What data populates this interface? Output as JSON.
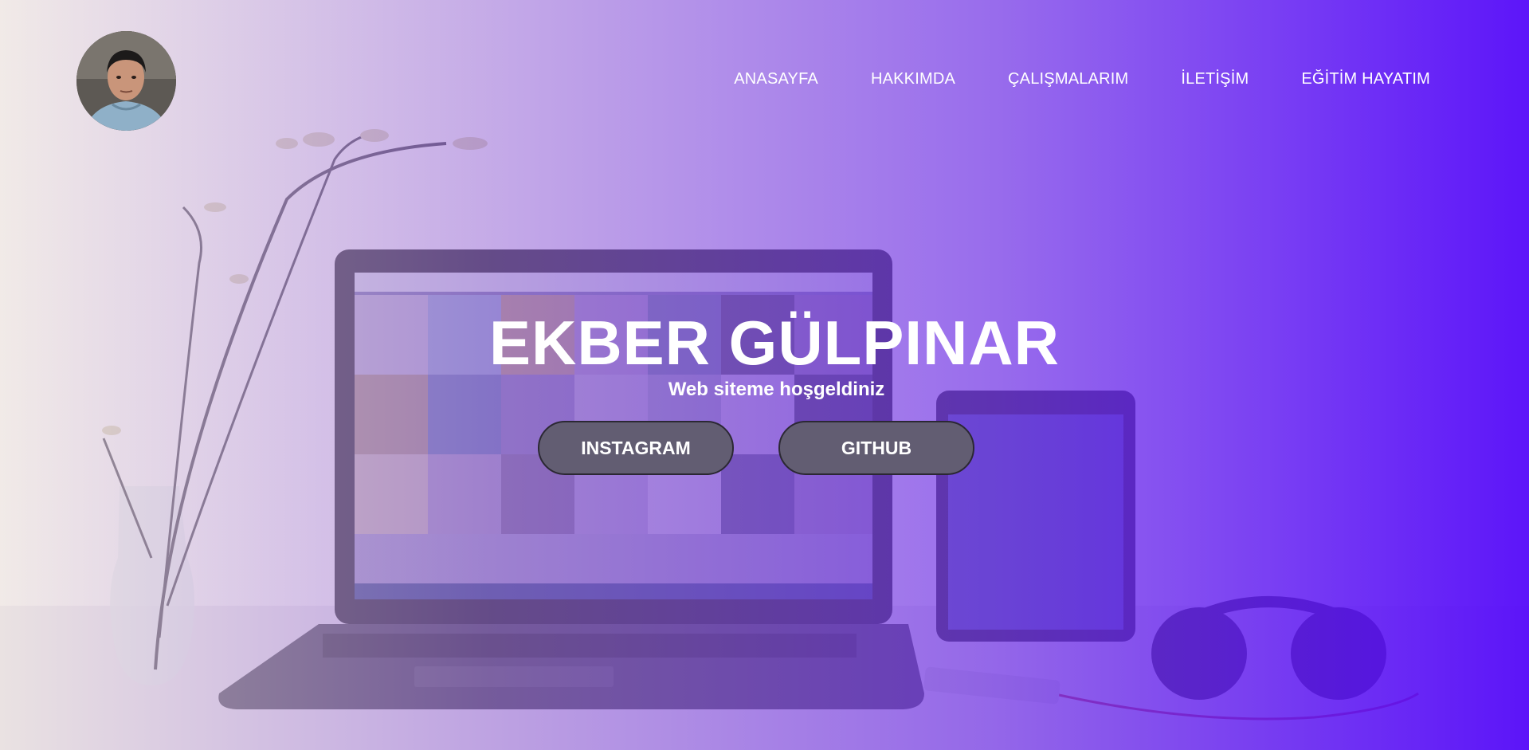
{
  "nav": {
    "items": [
      {
        "label": "ANASAYFA"
      },
      {
        "label": "HAKKIMDA"
      },
      {
        "label": "ÇALIŞMALARIM"
      },
      {
        "label": "İLETİŞİM"
      },
      {
        "label": "EĞİTİM HAYATIM"
      }
    ]
  },
  "hero": {
    "title": "EKBER GÜLPINAR",
    "subtitle": "Web siteme hoşgeldiniz",
    "buttons": [
      {
        "label": "INSTAGRAM"
      },
      {
        "label": "GITHUB"
      }
    ]
  },
  "colors": {
    "overlay_start": "#f5ebe1",
    "overlay_end": "#5500fa",
    "button_bg": "#625d72",
    "text": "#ffffff"
  }
}
